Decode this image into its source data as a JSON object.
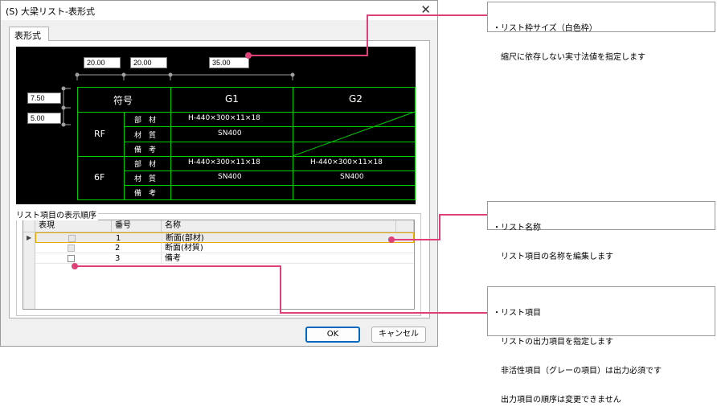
{
  "dialog": {
    "title": "(S) 大梁リスト-表形式",
    "close_icon": "close-icon",
    "tab_label": "表形式",
    "size_inputs": {
      "col1": "20.00",
      "col2": "20.00",
      "col3": "35.00",
      "row1": "7.50",
      "row2": "5.00"
    },
    "preview_table": {
      "header": {
        "label": "符号",
        "cols": [
          "G1",
          "G2"
        ]
      },
      "groups": [
        {
          "floor": "RF",
          "rows": [
            {
              "item": "部　材",
              "g1": "H-440×300×11×18",
              "g2": ""
            },
            {
              "item": "材　質",
              "g1": "SN400",
              "g2": ""
            },
            {
              "item": "備　考",
              "g1": "",
              "g2": ""
            }
          ]
        },
        {
          "floor": "6F",
          "rows": [
            {
              "item": "部　材",
              "g1": "H-440×300×11×18",
              "g2": "H-440×300×11×18"
            },
            {
              "item": "材　質",
              "g1": "SN400",
              "g2": "SN400"
            },
            {
              "item": "備　考",
              "g1": "",
              "g2": ""
            }
          ]
        }
      ]
    },
    "order_group_label": "リスト項目の表示順序",
    "order_grid": {
      "columns": [
        "表現",
        "番号",
        "名称"
      ],
      "rows": [
        {
          "visible": true,
          "no": "1",
          "name": "断面(部材)",
          "selected": true
        },
        {
          "visible": true,
          "no": "2",
          "name": "断面(材質)",
          "selected": false
        },
        {
          "visible": false,
          "no": "3",
          "name": "備考",
          "selected": false
        }
      ],
      "current_row_indicator": "triangle-right-icon"
    },
    "buttons": {
      "ok": "OK",
      "cancel": "キャンセル"
    }
  },
  "callouts": [
    {
      "lines": [
        "・リスト枠サイズ（白色枠）",
        "　縮尺に依存しない実寸法値を指定します"
      ]
    },
    {
      "lines": [
        "・リスト名称",
        "　リスト項目の名称を編集します"
      ]
    },
    {
      "lines": [
        "・リスト項目",
        "　リストの出力項目を指定します",
        "　非活性項目（グレーの項目）は出力必須です",
        "　出力項目の順序は変更できません"
      ]
    }
  ],
  "colors": {
    "accent": "#e0407a",
    "grid_line": "#00cc00",
    "ok_border": "#0067c0"
  }
}
